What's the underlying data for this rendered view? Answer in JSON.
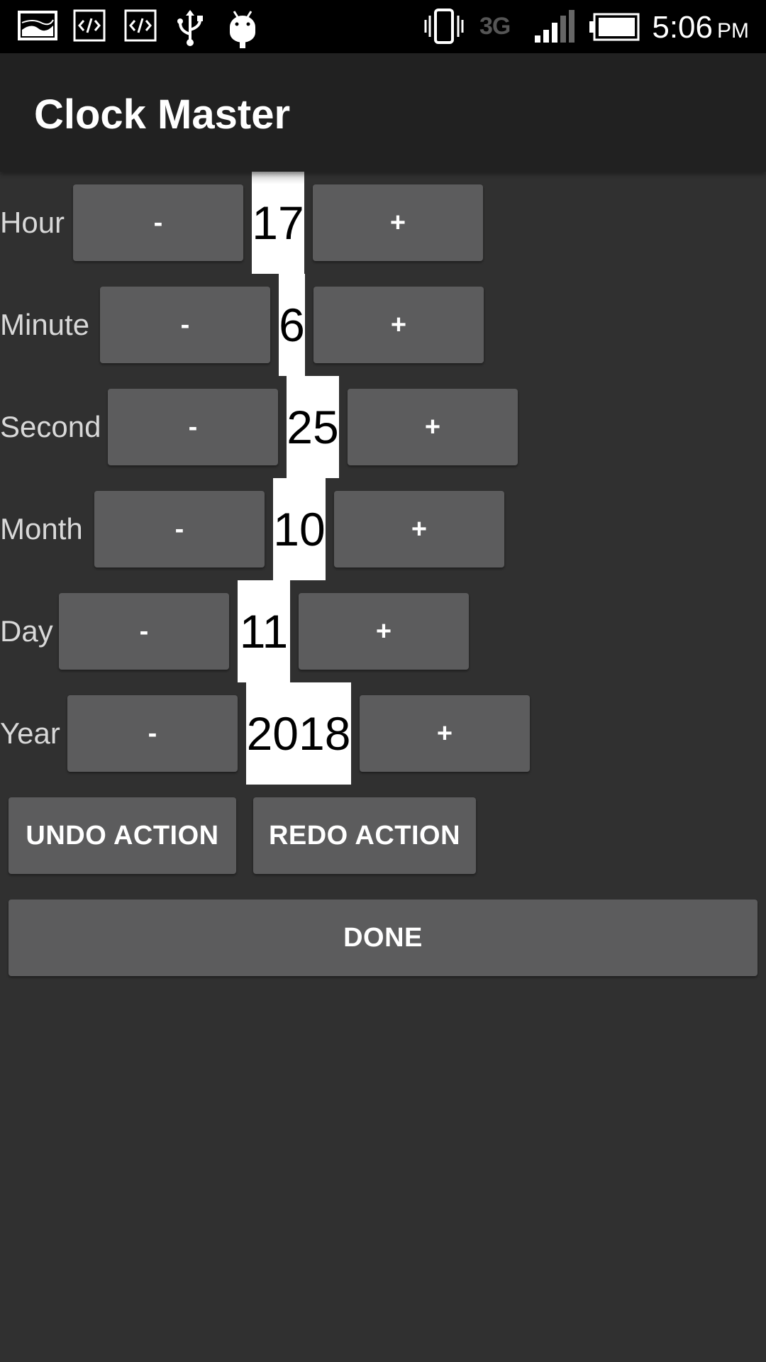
{
  "status_bar": {
    "time": "5:06",
    "ampm": "PM",
    "network": "3G",
    "icons": [
      "gallery-icon",
      "code-icon",
      "code-icon",
      "usb-icon",
      "android-debug-icon",
      "vibrate-icon",
      "signal-icon",
      "battery-icon"
    ]
  },
  "app": {
    "title": "Clock Master"
  },
  "rows": [
    {
      "label": "Hour",
      "minus": "-",
      "value": "17",
      "plus": "+"
    },
    {
      "label": "Minute",
      "minus": "-",
      "value": "6",
      "plus": "+"
    },
    {
      "label": "Second",
      "minus": "-",
      "value": "25",
      "plus": "+"
    },
    {
      "label": "Month",
      "minus": "-",
      "value": "10",
      "plus": "+"
    },
    {
      "label": "Day",
      "minus": "-",
      "value": "11",
      "plus": "+"
    },
    {
      "label": "Year",
      "minus": "-",
      "value": "2018",
      "plus": "+"
    }
  ],
  "actions": {
    "undo": "UNDO ACTION",
    "redo": "REDO ACTION",
    "done": "DONE"
  },
  "colors": {
    "background": "#303030",
    "appbar": "#212121",
    "button": "#5c5c5d",
    "value_bg": "#ffffff"
  }
}
